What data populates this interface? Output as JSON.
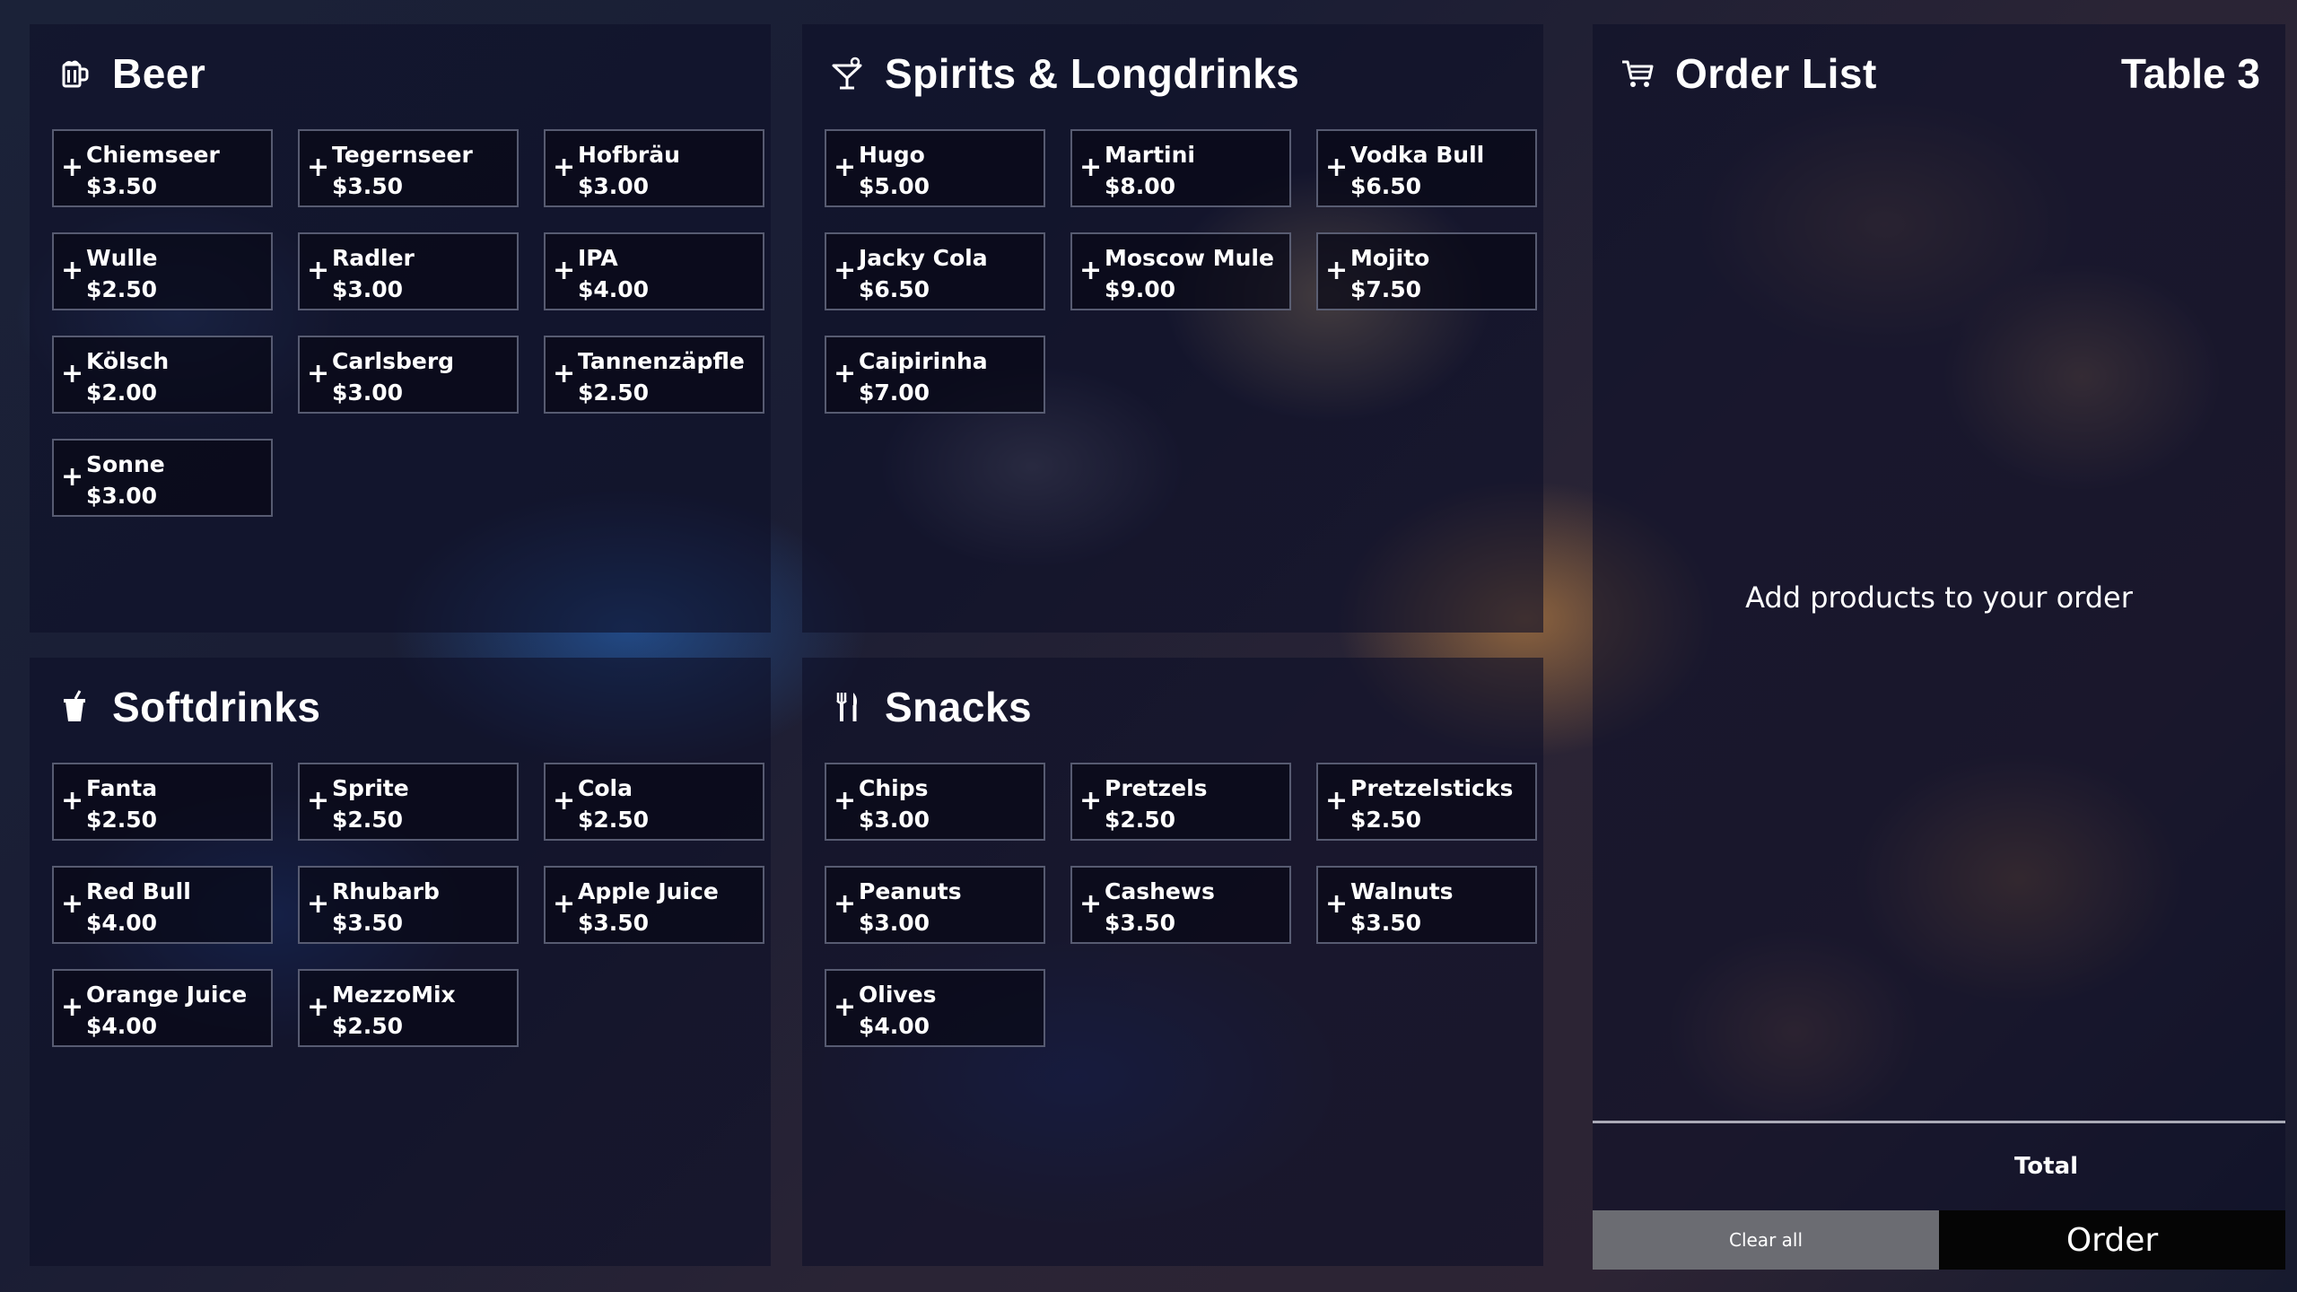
{
  "categories": [
    {
      "title": "Beer",
      "icon": "beer-mug-icon",
      "items": [
        {
          "name": "Chiemseer",
          "price": "$3.50"
        },
        {
          "name": "Tegernseer",
          "price": "$3.50"
        },
        {
          "name": "Hofbräu",
          "price": "$3.00"
        },
        {
          "name": "Wulle",
          "price": "$2.50"
        },
        {
          "name": "Radler",
          "price": "$3.00"
        },
        {
          "name": "IPA",
          "price": "$4.00"
        },
        {
          "name": "Kölsch",
          "price": "$2.00"
        },
        {
          "name": "Carlsberg",
          "price": "$3.00"
        },
        {
          "name": "Tannenzäpfle",
          "price": "$2.50"
        },
        {
          "name": "Sonne",
          "price": "$3.00"
        }
      ]
    },
    {
      "title": "Spirits & Longdrinks",
      "icon": "cocktail-glass-icon",
      "items": [
        {
          "name": "Hugo",
          "price": "$5.00"
        },
        {
          "name": "Martini",
          "price": "$8.00"
        },
        {
          "name": "Vodka Bull",
          "price": "$6.50"
        },
        {
          "name": "Jacky Cola",
          "price": "$6.50"
        },
        {
          "name": "Moscow Mule",
          "price": "$9.00"
        },
        {
          "name": "Mojito",
          "price": "$7.50"
        },
        {
          "name": "Caipirinha",
          "price": "$7.00"
        }
      ]
    },
    {
      "title": "Softdrinks",
      "icon": "soda-cup-icon",
      "items": [
        {
          "name": "Fanta",
          "price": "$2.50"
        },
        {
          "name": "Sprite",
          "price": "$2.50"
        },
        {
          "name": "Cola",
          "price": "$2.50"
        },
        {
          "name": "Red Bull",
          "price": "$4.00"
        },
        {
          "name": "Rhubarb",
          "price": "$3.50"
        },
        {
          "name": "Apple Juice",
          "price": "$3.50"
        },
        {
          "name": "Orange Juice",
          "price": "$4.00"
        },
        {
          "name": "MezzoMix",
          "price": "$2.50"
        }
      ]
    },
    {
      "title": "Snacks",
      "icon": "fork-knife-icon",
      "items": [
        {
          "name": "Chips",
          "price": "$3.00"
        },
        {
          "name": "Pretzels",
          "price": "$2.50"
        },
        {
          "name": "Pretzelsticks",
          "price": "$2.50"
        },
        {
          "name": "Peanuts",
          "price": "$3.00"
        },
        {
          "name": "Cashews",
          "price": "$3.50"
        },
        {
          "name": "Walnuts",
          "price": "$3.50"
        },
        {
          "name": "Olives",
          "price": "$4.00"
        }
      ]
    }
  ],
  "item_action_glyph": "+",
  "order": {
    "title": "Order List",
    "icon": "shopping-cart-icon",
    "table": "Table 3",
    "empty_message": "Add products to your order",
    "total_label": "Total",
    "clear_label": "Clear all",
    "order_label": "Order"
  },
  "colors": {
    "panel": "#0e1028",
    "clear_button": "#6b6c72",
    "order_button": "#050505"
  }
}
